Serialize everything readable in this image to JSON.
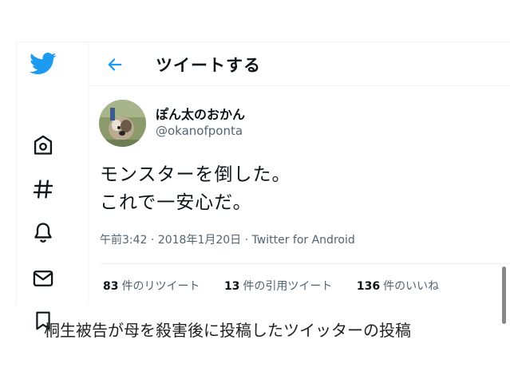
{
  "colors": {
    "brand": "#1d9bf0",
    "text": "#0f1419",
    "muted": "#536471",
    "border": "#eff3f4"
  },
  "sidebar": {
    "icons": [
      "twitter-bird-icon",
      "home-icon",
      "explore-hashtag-icon",
      "notifications-bell-icon",
      "messages-envelope-icon",
      "bookmarks-icon"
    ]
  },
  "header": {
    "back_icon": "arrow-left-icon",
    "title": "ツイートする"
  },
  "tweet": {
    "display_name": "ぽん太のおかん",
    "handle": "@okanofponta",
    "lines": [
      "モンスターを倒した。",
      "これで一安心だ。"
    ],
    "time": "午前3:42",
    "separator": "·",
    "date": "2018年1月20日",
    "client": "Twitter for Android"
  },
  "stats": {
    "retweets_count": "83",
    "retweets_label": "件のリツイート",
    "quotes_count": "13",
    "quotes_label": "件の引用ツイート",
    "likes_count": "136",
    "likes_label": "件のいいね"
  },
  "caption": "桐生被告が母を殺害後に投稿したツイッターの投稿"
}
